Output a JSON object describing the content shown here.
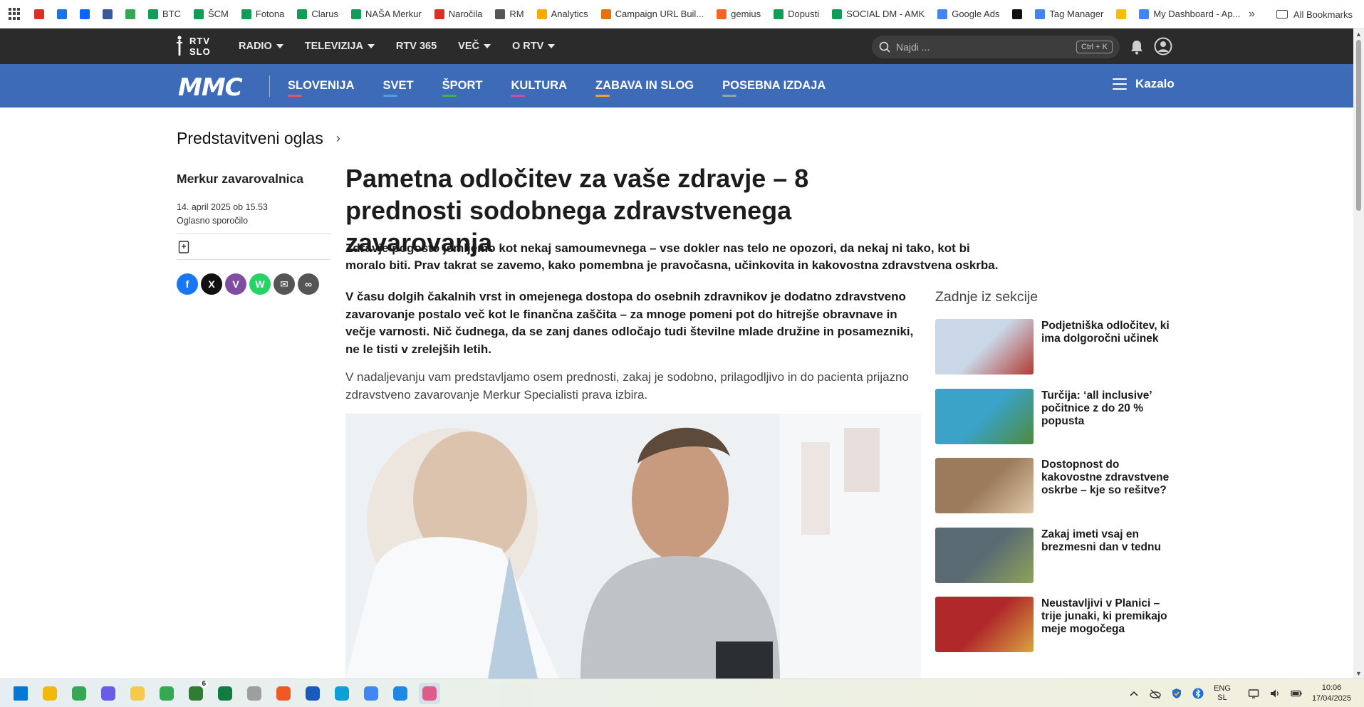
{
  "bookmarks": {
    "items": [
      {
        "label": "",
        "icon": "gmail-icon",
        "color": "#d93025"
      },
      {
        "label": "",
        "icon": "calendar-icon",
        "color": "#1a73e8"
      },
      {
        "label": "",
        "icon": "meta-icon",
        "color": "#0866ff"
      },
      {
        "label": "",
        "icon": "oculus-icon",
        "color": "#3b5998"
      },
      {
        "label": "",
        "icon": "check-icon",
        "color": "#34a853"
      },
      {
        "label": "BTC",
        "icon": "sheets-icon",
        "color": "#0f9d58"
      },
      {
        "label": "ŠCM",
        "icon": "sheets-icon",
        "color": "#0f9d58"
      },
      {
        "label": "Fotona",
        "icon": "sheets-icon",
        "color": "#0f9d58"
      },
      {
        "label": "Clarus",
        "icon": "sheets-icon",
        "color": "#0f9d58"
      },
      {
        "label": "NAŠA Merkur",
        "icon": "sheets-icon",
        "color": "#0f9d58"
      },
      {
        "label": "Naročila",
        "icon": "gmail-icon",
        "color": "#d93025"
      },
      {
        "label": "RM",
        "icon": "dots-icon",
        "color": "#555555"
      },
      {
        "label": "Analytics",
        "icon": "analytics-icon",
        "color": "#f9ab00"
      },
      {
        "label": "Campaign URL Buil...",
        "icon": "campaign-icon",
        "color": "#e8710a"
      },
      {
        "label": "gemius",
        "icon": "gemius-icon",
        "color": "#f26522"
      },
      {
        "label": "Dopusti",
        "icon": "sheets-icon",
        "color": "#0f9d58"
      },
      {
        "label": "SOCIAL DM - AMK",
        "icon": "sheets-icon",
        "color": "#0f9d58"
      },
      {
        "label": "Google Ads",
        "icon": "ads-icon",
        "color": "#4285f4"
      },
      {
        "label": "",
        "icon": "tiktok-icon",
        "color": "#111111"
      },
      {
        "label": "Tag Manager",
        "icon": "tag-manager-icon",
        "color": "#4285f4"
      },
      {
        "label": "",
        "icon": "drive-icon",
        "color": "#fbbc04"
      },
      {
        "label": "My Dashboard - Ap...",
        "icon": "google-icon",
        "color": "#4285f4"
      }
    ],
    "more": "»",
    "all_bookmarks": "All Bookmarks"
  },
  "topnav": {
    "logo_line1": "RTV",
    "logo_line2": "SLO",
    "items": [
      {
        "label": "RADIO",
        "caret": true
      },
      {
        "label": "TELEVIZIJA",
        "caret": true
      },
      {
        "label": "RTV 365",
        "caret": false
      },
      {
        "label": "VEČ",
        "caret": true
      },
      {
        "label": "O RTV",
        "caret": true
      }
    ],
    "search_placeholder": "Najdi ...",
    "search_shortcut": "Ctrl + K"
  },
  "mmc": {
    "logo": "MMC",
    "items": [
      {
        "label": "SLOVENIJA",
        "accent": "#e05a5a"
      },
      {
        "label": "SVET",
        "accent": "#4aa0e0"
      },
      {
        "label": "ŠPORT",
        "accent": "#3cb44b"
      },
      {
        "label": "KULTURA",
        "accent": "#d04da0"
      },
      {
        "label": "ZABAVA IN SLOG",
        "accent": "#f2a13a"
      },
      {
        "label": "POSEBNA IZDAJA",
        "accent": "#9aa0a8"
      }
    ],
    "kazalo": "Kazalo"
  },
  "article": {
    "section": "Predstavitveni oglas",
    "author": "Merkur zavarovalnica",
    "date": "14. april 2025 ob 15.53",
    "type": "Oglasno sporočilo",
    "headline": "Pametna odločitev za vaše zdravje – 8 prednosti sodobnega zdravstvenega zavarovanja",
    "lead": "Zdravje pogosto jemljemo kot nekaj samoumevnega – vse dokler nas telo ne opozori, da nekaj ni tako, kot bi moralo biti. Prav takrat se zavemo, kako pomembna je pravočasna, učinkovita in kakovostna zdravstvena oskrba.",
    "para1": "V času dolgih čakalnih vrst in omejenega dostopa do osebnih zdravnikov je dodatno zdravstveno zavarovanje postalo več kot le finančna zaščita – za mnoge pomeni pot do hitrejše obravnave in večje varnosti. Nič čudnega, da se zanj danes odločajo tudi številne mlade družine in posamezniki, ne le tisti v zrelejših letih.",
    "para2": "V nadaljevanju vam predstavljamo osem prednosti, zakaj je sodobno, prilagodljivo in do pacienta prijazno zdravstveno zavarovanje Merkur Specialisti prava izbira."
  },
  "share": [
    {
      "icon": "facebook-icon",
      "color": "#1877f2",
      "glyph": "f"
    },
    {
      "icon": "x-icon",
      "color": "#111111",
      "glyph": "X"
    },
    {
      "icon": "viber-icon",
      "color": "#7f4ea3",
      "glyph": "V"
    },
    {
      "icon": "whatsapp-icon",
      "color": "#25d366",
      "glyph": "W"
    },
    {
      "icon": "email-icon",
      "color": "#555555",
      "glyph": "✉"
    },
    {
      "icon": "link-icon",
      "color": "#555555",
      "glyph": "∞"
    }
  ],
  "sidebar": {
    "title": "Zadnje iz sekcije",
    "items": [
      {
        "title": "Podjetniška odločitev, ki ima dolgoročni učinek",
        "thumb": [
          "#c9d7e6",
          "#b23b33"
        ]
      },
      {
        "title": "Turčija: ‘all inclusive’ počitnice z do 20 % popusta",
        "thumb": [
          "#3aa3c7",
          "#4e8a3b"
        ]
      },
      {
        "title": "Dostopnost do kakovostne zdravstvene oskrbe – kje so rešitve?",
        "thumb": [
          "#9c7a5c",
          "#e0c9a8"
        ]
      },
      {
        "title": "Zakaj imeti vsaj en brezmesni dan v tednu",
        "thumb": [
          "#5a6b73",
          "#8fa35a"
        ]
      },
      {
        "title": "Neustavljivi v Planici – trije junaki, ki premikajo meje mogočega",
        "thumb": [
          "#b0282a",
          "#d9a441"
        ]
      }
    ]
  },
  "taskbar": {
    "apps": [
      {
        "icon": "windows-start-icon",
        "color": "#0078d4"
      },
      {
        "icon": "file-explorer-icon",
        "color": "#f2b90c"
      },
      {
        "icon": "chrome-icon",
        "color": "#34a853"
      },
      {
        "icon": "snipping-tool-icon",
        "color": "#6b5ce7"
      },
      {
        "icon": "sticky-notes-icon",
        "color": "#f7c948"
      },
      {
        "icon": "chrome-profile-icon",
        "color": "#34a853"
      },
      {
        "icon": "teams-chat-icon",
        "color": "#2e7d32",
        "badge": "6"
      },
      {
        "icon": "excel-icon",
        "color": "#107c41"
      },
      {
        "icon": "notepad-icon",
        "color": "#9e9e9e"
      },
      {
        "icon": "app-orange-icon",
        "color": "#ef5a24"
      },
      {
        "icon": "word-icon",
        "color": "#185abd"
      },
      {
        "icon": "edge-icon",
        "color": "#0c9fd8"
      },
      {
        "icon": "chrome-alt-icon",
        "color": "#4285f4"
      },
      {
        "icon": "photos-icon",
        "color": "#1e88e5"
      },
      {
        "icon": "screen-tool-icon",
        "color": "#e05a8a"
      }
    ],
    "lang_line1": "ENG",
    "lang_line2": "SL",
    "time": "10:06",
    "date": "17/04/2025"
  }
}
